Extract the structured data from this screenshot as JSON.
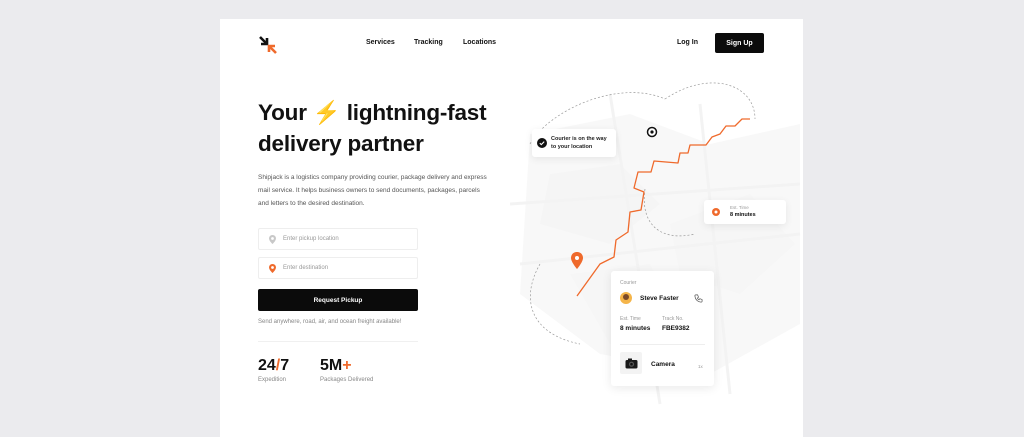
{
  "nav": {
    "items": [
      "Services",
      "Tracking",
      "Locations"
    ],
    "login_label": "Log In",
    "signup_label": "Sign Up"
  },
  "hero": {
    "headline_part1": "Your ",
    "bolt_icon": "⚡",
    "headline_part2": " lightning-fast",
    "headline_line2": "delivery partner",
    "description": "Shipjack is a logistics company providing courier, package delivery and express mail service. It helps business owners to send documents, packages, parcels and letters to the desired destination."
  },
  "form": {
    "pickup_placeholder": "Enter pickup location",
    "destination_placeholder": "Enter destination",
    "request_label": "Request Pickup",
    "tagline": "Send anywhere, road, air, and ocean freight available!"
  },
  "stats": [
    {
      "value": "24",
      "accent": "/",
      "value_end": "7",
      "label": "Expedition"
    },
    {
      "value": "5M",
      "accent": "+",
      "value_end": "",
      "label": "Packages Delivered"
    }
  ],
  "map": {
    "courier_status": "Courier is on the way",
    "courier_status_line2": "to your location",
    "eta_label": "Est. Time",
    "eta_value": "8 minutes"
  },
  "panel": {
    "courier_label": "Courier",
    "courier_name": "Steve Faster",
    "est_label": "Est. Time",
    "est_value": "8 minutes",
    "track_label": "Track No.",
    "track_value": "FBE9382",
    "item_name": "Camera",
    "item_qty": "1x"
  },
  "colors": {
    "accent": "#ef6a2c",
    "primary": "#0b0b0b",
    "bolt": "#f3a238"
  }
}
